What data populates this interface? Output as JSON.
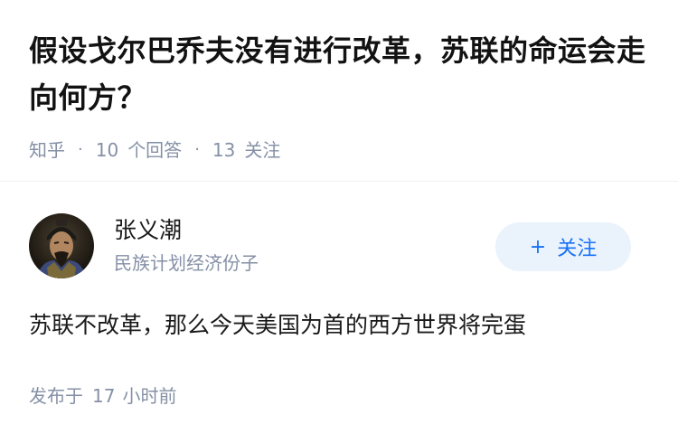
{
  "question": {
    "title": "假设戈尔巴乔夫没有进行改革，苏联的命运会走向何方？",
    "source": "知乎",
    "answers_count": "10",
    "answers_label": "个回答",
    "followers_count": "13",
    "followers_label": "关注"
  },
  "author": {
    "name": "张义潮",
    "bio": "民族计划经济份子",
    "avatar_icon": "avatar-portrait",
    "follow_plus": "+",
    "follow_label": "关注"
  },
  "answer": {
    "text": "苏联不改革，那么今天美国为首的西方世界将完蛋",
    "published_prefix": "发布于",
    "published_num": "17",
    "published_unit": "小时前"
  },
  "colors": {
    "accent": "#1772f6",
    "accent_bg": "#eaf2fc",
    "meta_gray": "#8590a6",
    "title": "#121212"
  }
}
